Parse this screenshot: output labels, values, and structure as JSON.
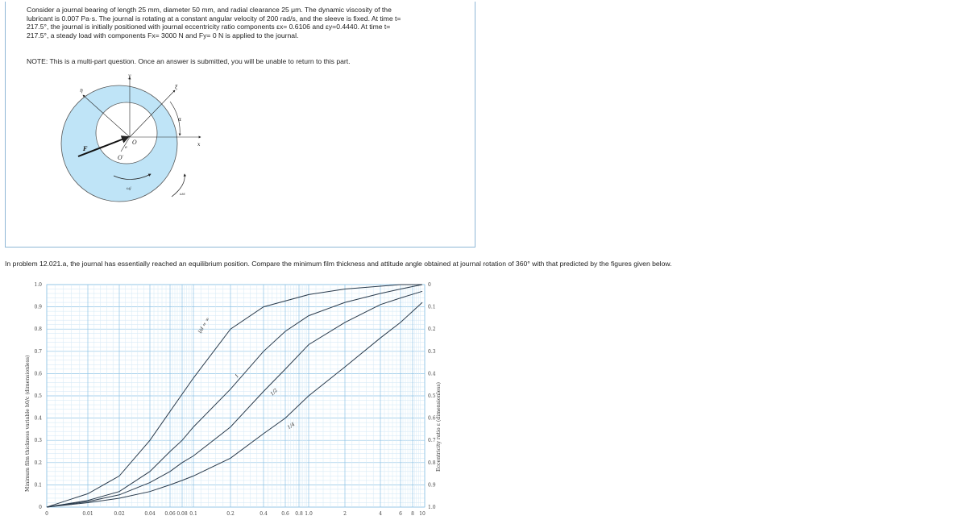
{
  "problem": {
    "text_lines": [
      "Consider a journal bearing of length 25 mm, diameter 50 mm, and radial clearance 25 μm. The dynamic viscosity of the",
      "lubricant is 0.007 Pa·s. The journal is rotating at a constant angular velocity of 200 rad/s, and the sleeve is fixed. At time t=",
      "217.5°, the journal is initially positioned with journal eccentricity ratio components εx= 0.6106 and εy=0.4440. At time t=",
      "217.5°, a steady load with components Fx= 3000 N and Fy= 0 N is applied to the journal."
    ],
    "note": "NOTE: This is a multi-part question. Once an answer is submitted, you will be unable to return to this part."
  },
  "diagram": {
    "labels": {
      "y": "y",
      "x": "x",
      "eta": "η",
      "xi": "ξ",
      "alpha": "α",
      "F": "F",
      "O": "O",
      "O_prime": "O′",
      "e": "e",
      "omega_j": "ωj",
      "omega_s": "ωs"
    }
  },
  "question": "In problem 12.021.a, the journal has essentially reached an equilibrium position. Compare the minimum film thickness and attitude angle obtained at journal rotation of 360° with that predicted by the figures given below.",
  "chart_data": {
    "type": "line",
    "x_scale": "log-like",
    "xlabel": "",
    "ylabel": "Minimum film thickness variable  h0/c  (dimensionless)",
    "y2label": "Eccentricity ratio ε (dimensionless)",
    "x_ticks": [
      "0",
      "0.01",
      "0.02",
      "0.04",
      "0.06",
      "0.08",
      "0.1",
      "0.2",
      "0.4",
      "0.6",
      "0.8",
      "1.0",
      "2",
      "4",
      "6",
      "8",
      "10"
    ],
    "y_ticks": [
      "0",
      "0.1",
      "0.2",
      "0.3",
      "0.4",
      "0.5",
      "0.6",
      "0.7",
      "0.8",
      "0.9",
      "1.0"
    ],
    "y2_ticks": [
      "0",
      "0.1",
      "0.2",
      "0.3",
      "0.4",
      "0.5",
      "0.6",
      "0.7",
      "0.8",
      "0.9",
      "1.0"
    ],
    "ylim": [
      0,
      1
    ],
    "grid": true,
    "series": [
      {
        "name": "l/d = ∞",
        "x": [
          0,
          0.005,
          0.01,
          0.02,
          0.04,
          0.06,
          0.1,
          0.2,
          0.4,
          1.0,
          2,
          6,
          10
        ],
        "y": [
          0,
          0.03,
          0.06,
          0.14,
          0.3,
          0.43,
          0.58,
          0.8,
          0.9,
          0.955,
          0.98,
          1.0,
          1.0
        ]
      },
      {
        "name": "1",
        "x": [
          0,
          0.01,
          0.02,
          0.04,
          0.06,
          0.08,
          0.1,
          0.2,
          0.4,
          0.6,
          1.0,
          2,
          4,
          6,
          10
        ],
        "y": [
          0,
          0.03,
          0.07,
          0.16,
          0.25,
          0.3,
          0.36,
          0.53,
          0.7,
          0.79,
          0.86,
          0.92,
          0.96,
          0.98,
          1.0
        ]
      },
      {
        "name": "1/2",
        "x": [
          0,
          0.01,
          0.02,
          0.04,
          0.06,
          0.08,
          0.1,
          0.2,
          0.4,
          0.6,
          1.0,
          2,
          4,
          6,
          10
        ],
        "y": [
          0,
          0.025,
          0.055,
          0.11,
          0.16,
          0.2,
          0.23,
          0.36,
          0.52,
          0.62,
          0.73,
          0.83,
          0.91,
          0.94,
          0.97
        ]
      },
      {
        "name": "1/4",
        "x": [
          0,
          0.01,
          0.02,
          0.04,
          0.06,
          0.08,
          0.1,
          0.2,
          0.4,
          0.6,
          1.0,
          2,
          4,
          6,
          10
        ],
        "y": [
          0,
          0.02,
          0.04,
          0.07,
          0.1,
          0.12,
          0.14,
          0.22,
          0.33,
          0.4,
          0.5,
          0.63,
          0.76,
          0.83,
          0.92
        ]
      }
    ],
    "curve_labels": [
      "l/d = ∞",
      "1",
      "1/2",
      "1/4"
    ]
  }
}
